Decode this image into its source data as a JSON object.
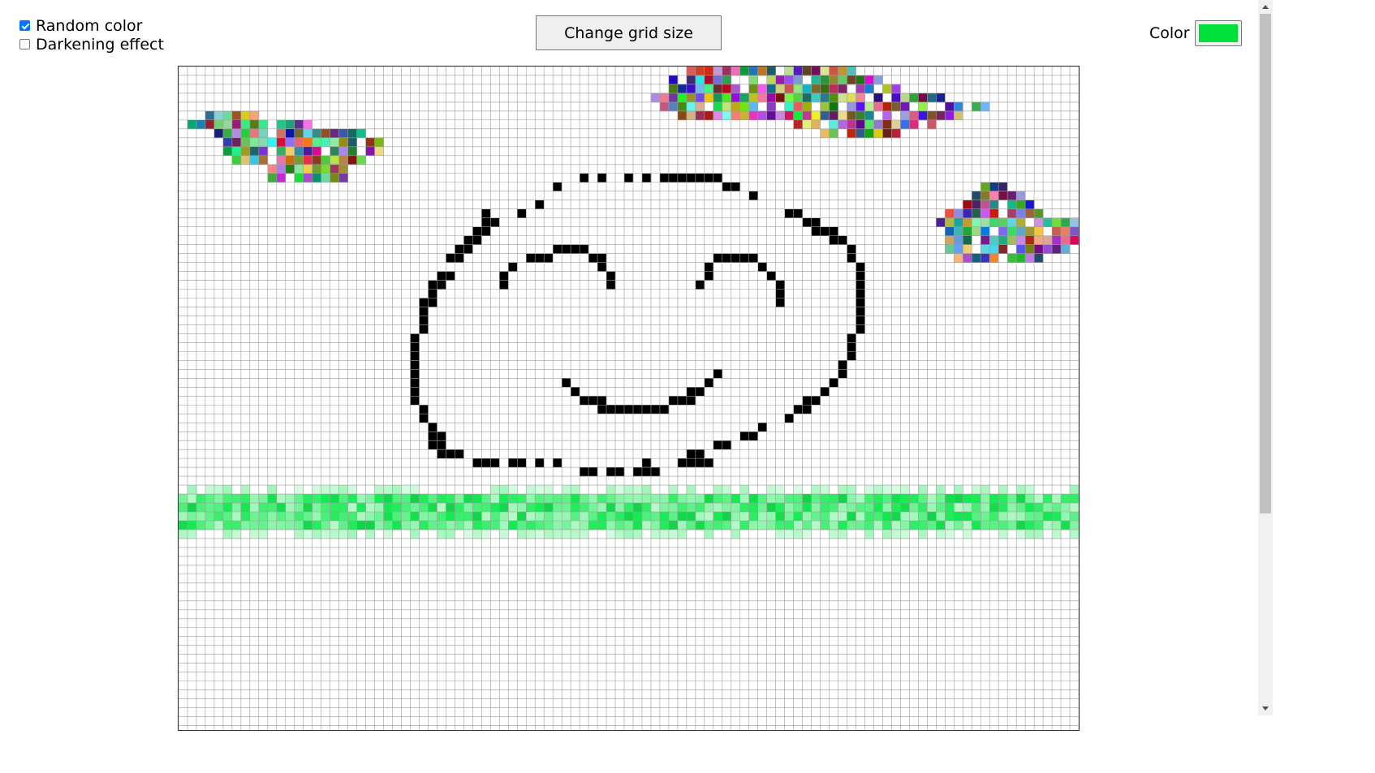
{
  "options": {
    "random_color": {
      "label": "Random color",
      "checked": true
    },
    "darkening": {
      "label": "Darkening effect",
      "checked": false
    }
  },
  "toolbar": {
    "change_grid_label": "Change grid size"
  },
  "color_picker": {
    "label": "Color",
    "value": "#00e03a"
  },
  "grid": {
    "columns": 101,
    "line_color": "#9e9e9e",
    "background": "#ffffff",
    "ink_color": "#000000",
    "grass_color": "#00e03a"
  }
}
